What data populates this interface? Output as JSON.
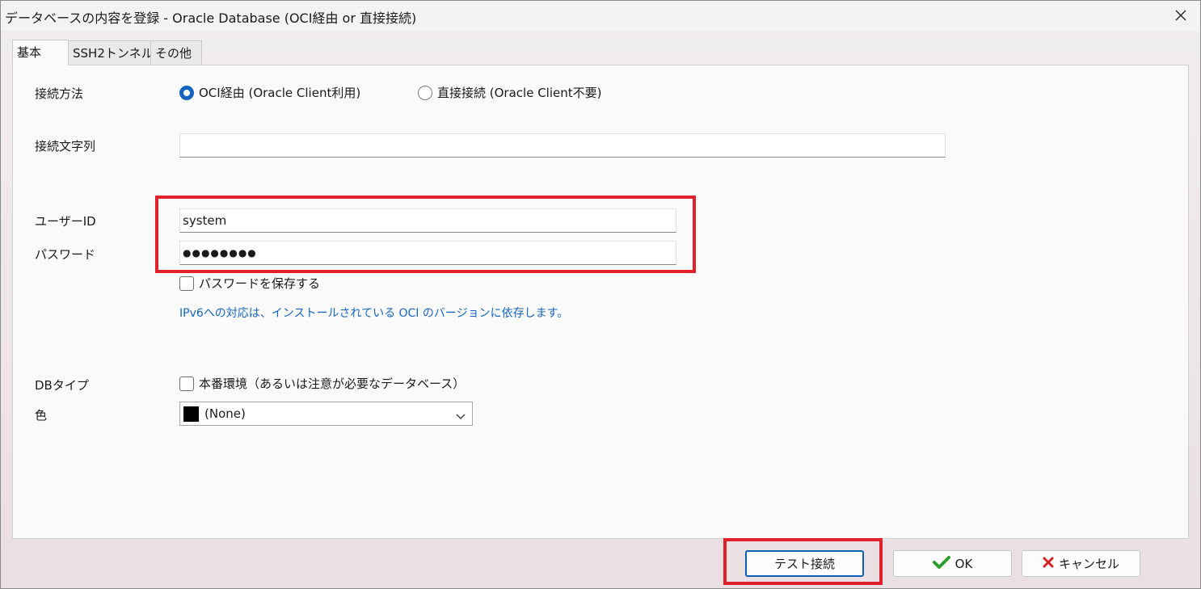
{
  "window": {
    "title": "データベースの内容を登録 - Oracle Database (OCI経由 or 直接接続)",
    "close_icon": "close-icon"
  },
  "tabs": [
    {
      "label": "基本",
      "active": true
    },
    {
      "label": "SSH2トンネル",
      "active": false
    },
    {
      "label": "その他",
      "active": false
    }
  ],
  "form": {
    "connection_method": {
      "label": "接続方法",
      "options": [
        {
          "label": "OCI経由 (Oracle Client利用)",
          "checked": true
        },
        {
          "label": "直接接続 (Oracle Client不要)",
          "checked": false
        }
      ]
    },
    "connection_string": {
      "label": "接続文字列",
      "value": ""
    },
    "user_id": {
      "label": "ユーザーID",
      "value": "system"
    },
    "password": {
      "label": "パスワード",
      "value": "●●●●●●●●"
    },
    "save_password": {
      "label": "パスワードを保存する",
      "checked": false
    },
    "ipv6_note": "IPv6への対応は、インストールされている OCI のバージョンに依存します。",
    "db_type": {
      "label": "DBタイプ",
      "checkbox_label": "本番環境（あるいは注意が必要なデータベース）",
      "checked": false
    },
    "color": {
      "label": "色",
      "value": "(None)",
      "swatch": "#000000"
    }
  },
  "buttons": {
    "test": "テスト接続",
    "ok": "OK",
    "cancel": "キャンセル"
  },
  "colors": {
    "highlight": "#e0202a",
    "accent": "#1565c0",
    "ok_icon": "#2e9d2e",
    "cancel_icon": "#d42020"
  }
}
